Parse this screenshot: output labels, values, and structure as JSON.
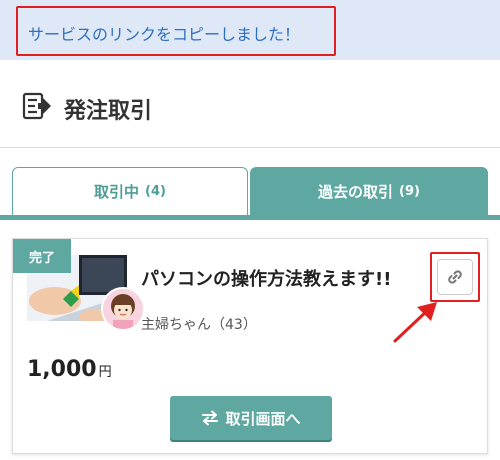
{
  "toast": {
    "message": "サービスのリンクをコピーしました！"
  },
  "header": {
    "title": "発注取引",
    "icon": "document-arrow-icon"
  },
  "tabs": [
    {
      "label": "取引中",
      "count": "(4)",
      "active": true
    },
    {
      "label": "過去の取引",
      "count": "(9)",
      "active": false
    }
  ],
  "order": {
    "status_badge": "完了",
    "title": "パソコンの操作方法教えます!!",
    "seller": "主婦ちゃん（43）",
    "price": "1,000",
    "currency": "円",
    "copy_link_icon": "link-icon",
    "open_button_label": "取引画面へ",
    "open_button_icon": "swap-arrows-icon"
  },
  "colors": {
    "accent": "#5fa8a2",
    "toast_bg": "#dfe8f6",
    "toast_text": "#2f6fbf",
    "highlight": "#e02020"
  }
}
